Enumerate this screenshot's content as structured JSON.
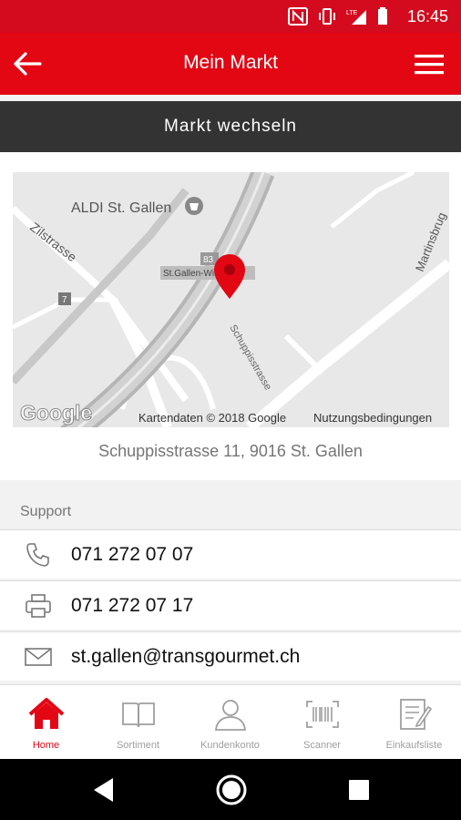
{
  "status_bar": {
    "time": "16:45",
    "network": "LTE"
  },
  "app_bar": {
    "title": "Mein Markt"
  },
  "switch_bar": {
    "label": "Markt wechseln"
  },
  "map": {
    "labels": {
      "store": "ALDI St. Gallen",
      "street1": "Zilstrasse",
      "street2": "Martinsbrug",
      "street3": "Schuppisstrasse",
      "stop": "St.Gallen-Winkelnd",
      "road_number": "83",
      "road_number_2": "7",
      "logo": "Google",
      "copyright": "Kartendaten © 2018 Google",
      "terms": "Nutzungsbedingungen"
    }
  },
  "address": "Schuppisstrasse 11, 9016 St. Gallen",
  "support": {
    "header": "Support",
    "phone": "071 272 07 07",
    "fax": "071 272 07 17",
    "email": "st.gallen@transgourmet.ch"
  },
  "bottom_nav": {
    "items": [
      {
        "label": "Home",
        "icon": "home-icon",
        "active": true
      },
      {
        "label": "Sortiment",
        "icon": "book-icon",
        "active": false
      },
      {
        "label": "Kundenkonto",
        "icon": "person-icon",
        "active": false
      },
      {
        "label": "Scanner",
        "icon": "barcode-icon",
        "active": false
      },
      {
        "label": "Einkaufsliste",
        "icon": "notepad-icon",
        "active": false
      }
    ]
  },
  "colors": {
    "brand_red": "#e30613",
    "dark_bar": "#333333",
    "gray_text": "#757575"
  }
}
